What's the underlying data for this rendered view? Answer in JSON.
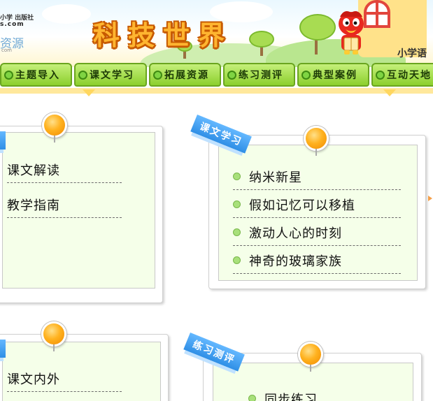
{
  "header": {
    "publisher_top": "小学 出版社",
    "publisher_domain": "s.com",
    "resource_text": "资源",
    "resource_domain": "com",
    "site_title": "科技世界",
    "grade_label": "小学语"
  },
  "nav": {
    "tabs": [
      {
        "label": "主题导入"
      },
      {
        "label": "课文学习"
      },
      {
        "label": "拓展资源"
      },
      {
        "label": "练习测评"
      },
      {
        "label": "典型案例"
      },
      {
        "label": "互动天地"
      }
    ]
  },
  "cards": {
    "left_top": {
      "items": [
        "课文解读",
        "教学指南"
      ]
    },
    "right_top": {
      "ribbon": "课文学习",
      "items": [
        "纳米新星",
        "假如记忆可以移植",
        "激动人心的时刻",
        "神奇的玻璃家族"
      ]
    },
    "left_bottom": {
      "items": [
        "课文内外"
      ]
    },
    "right_bottom": {
      "ribbon": "练习测评",
      "items": [
        "同步练习"
      ]
    }
  },
  "colors": {
    "nav_green": "#8ccf2d",
    "ribbon_blue": "#2f8fe6",
    "title_orange": "#ffb530",
    "card_bg": "#f5ffe9"
  }
}
